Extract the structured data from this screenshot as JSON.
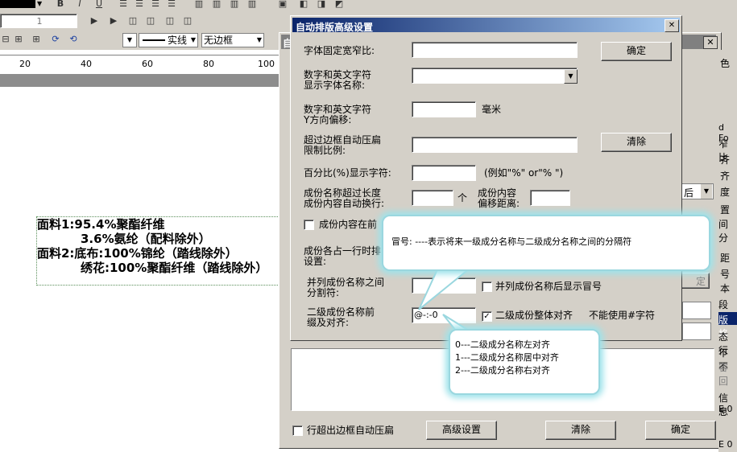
{
  "toolbar": {
    "font_style_buttons": [
      "B",
      "I",
      "U"
    ],
    "font_size_value": "1",
    "line_style": "实线",
    "border_style": "无边框"
  },
  "ruler": {
    "ticks": [
      "20",
      "40",
      "60",
      "80",
      "100"
    ]
  },
  "document": {
    "lines": [
      "面料1:95.4%聚酯纤维",
      "3.6%氨纶（配料除外）",
      "面料2:底布:100%锦纶（踏线除外）",
      "绣花:100%聚酯纤维（踏线除外）"
    ]
  },
  "bg_dialog": {
    "title_char": "自",
    "side_labels": [
      "色",
      "",
      "d Fo",
      "窄比",
      "齐",
      "齐",
      "度",
      "后!",
      "置",
      "间分",
      "距",
      "号",
      "本",
      "段设",
      "版格",
      "态行",
      "不不",
      "容回",
      "信息",
      "E 0",
      "E 0"
    ],
    "dropdown_text": "后",
    "gray_button_label": "定",
    "bottom_checkbox_label": "行超出边框自动压扁",
    "advanced_button": "高级设置",
    "clear_button": "清除",
    "ok_button": "确定"
  },
  "dialog": {
    "title": "自动排版高级设置",
    "close_glyph": "✕",
    "ok_button": "确定",
    "clear_button": "清除",
    "rows": {
      "fixed_width": {
        "label": "字体固定宽窄比:",
        "value": ""
      },
      "font_name": {
        "label_1": "数字和英文字符",
        "label_2": "显示字体名称:",
        "value": ""
      },
      "y_offset": {
        "label_1": "数字和英文字符",
        "label_2": "Y方向偏移:",
        "value": "",
        "unit": "毫米"
      },
      "compress": {
        "label_1": "超过边框自动压扁",
        "label_2": "限制比例:",
        "value": ""
      },
      "percent": {
        "label": "百分比(%)显示字符:",
        "value": "",
        "hint": "(例如\"%\" or\"% \")"
      },
      "wrap": {
        "label_1": "成份名称超过长度",
        "label_2": "成份内容自动换行:",
        "value": "",
        "unit": "个",
        "label_3": "成份内容",
        "label_4": "偏移距离:",
        "value_2": ""
      },
      "content_before": {
        "label": "成份内容在前"
      },
      "occupy": {
        "label_1": "成份各占一行时排",
        "label_2": "设置:"
      },
      "separator": {
        "label_1": "并列成份名称之间",
        "label_2": "分割符:",
        "value": "",
        "cb_label": "并列成份名称后显示冒号"
      },
      "second_level": {
        "label_1": "二级成份名称前",
        "label_2": "缀及对齐:",
        "value": "@-:-0",
        "cb_checked": "✓",
        "cb_label": "二级成份整体对齐",
        "note": "不能使用#字符"
      }
    }
  },
  "callouts": {
    "colon_tip": "冒号: ----表示将来一级成分名称与二级成分名称之间的分隔符",
    "align_tips": [
      "0---二级成分名称左对齐",
      "1---二级成分名称居中对齐",
      "2---二级成分名称右对齐"
    ]
  }
}
